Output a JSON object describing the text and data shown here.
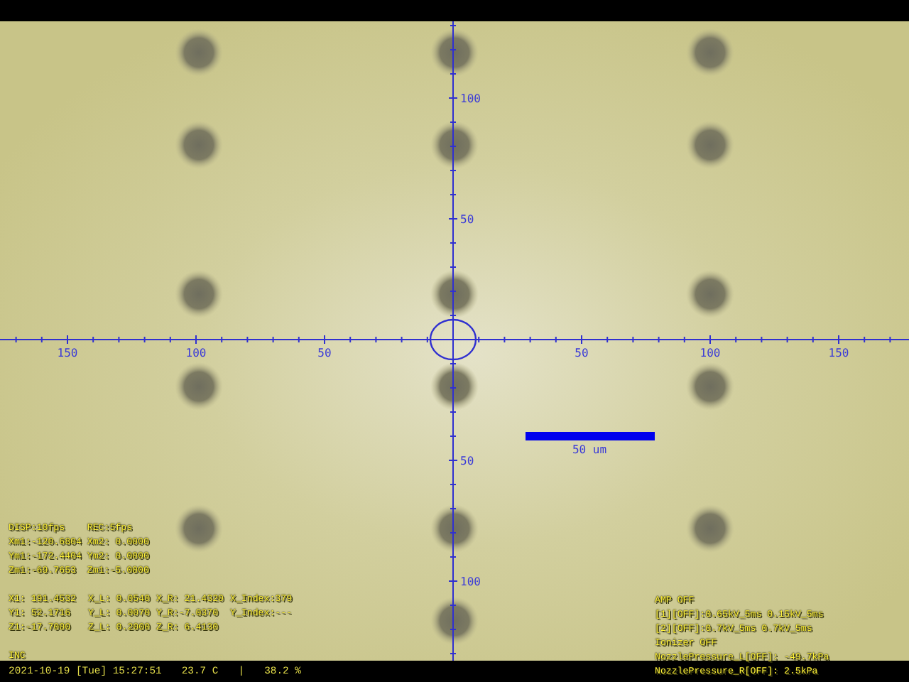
{
  "view": {
    "x_axis_labels": [
      "150",
      "100",
      "50",
      "50",
      "100",
      "150"
    ],
    "y_axis_labels": [
      "100",
      "50",
      "50",
      "100"
    ],
    "scale_bar": {
      "label": "50 um"
    }
  },
  "left_overlay": {
    "lines": [
      "DISP:10fps    REC:5fps",
      "Xm1:-120.6804 Xm2: 0.0000",
      "Ym1:-172.4404 Ym2: 0.0000",
      "Zm1:-69.7653  Zm1:-5.0000"
    ],
    "readout_rows": [
      [
        "X1: 191.4532",
        "X_L: 0.0540",
        "X_R: 21.4320",
        "X_Index:379"
      ],
      [
        "Y1: 52.1716",
        "Y_L: 0.0070",
        "Y_R:-7.0370",
        "Y_Index:---"
      ],
      [
        "Z1:-17.7000",
        "Z_L: 0.2000",
        "Z_R: 6.4130"
      ]
    ],
    "mode": "INC"
  },
  "right_overlay": {
    "lines": [
      "AMP OFF",
      "[1][OFF]:0.65kV_5ms 0.15kV_5ms",
      "[2][OFF]:0.7kV_5ms 0.7kV_5ms",
      "Ionizer OFF",
      "NozzlePressure_L[OFF]: -49.7kPa",
      "NozzlePressure_R[OFF]: 2.5kPa"
    ]
  },
  "status_bar": {
    "datetime": "2021-10-19 [Tue] 15:27:51",
    "temperature": "23.7 C",
    "separator": "|",
    "humidity": "38.2 %"
  }
}
